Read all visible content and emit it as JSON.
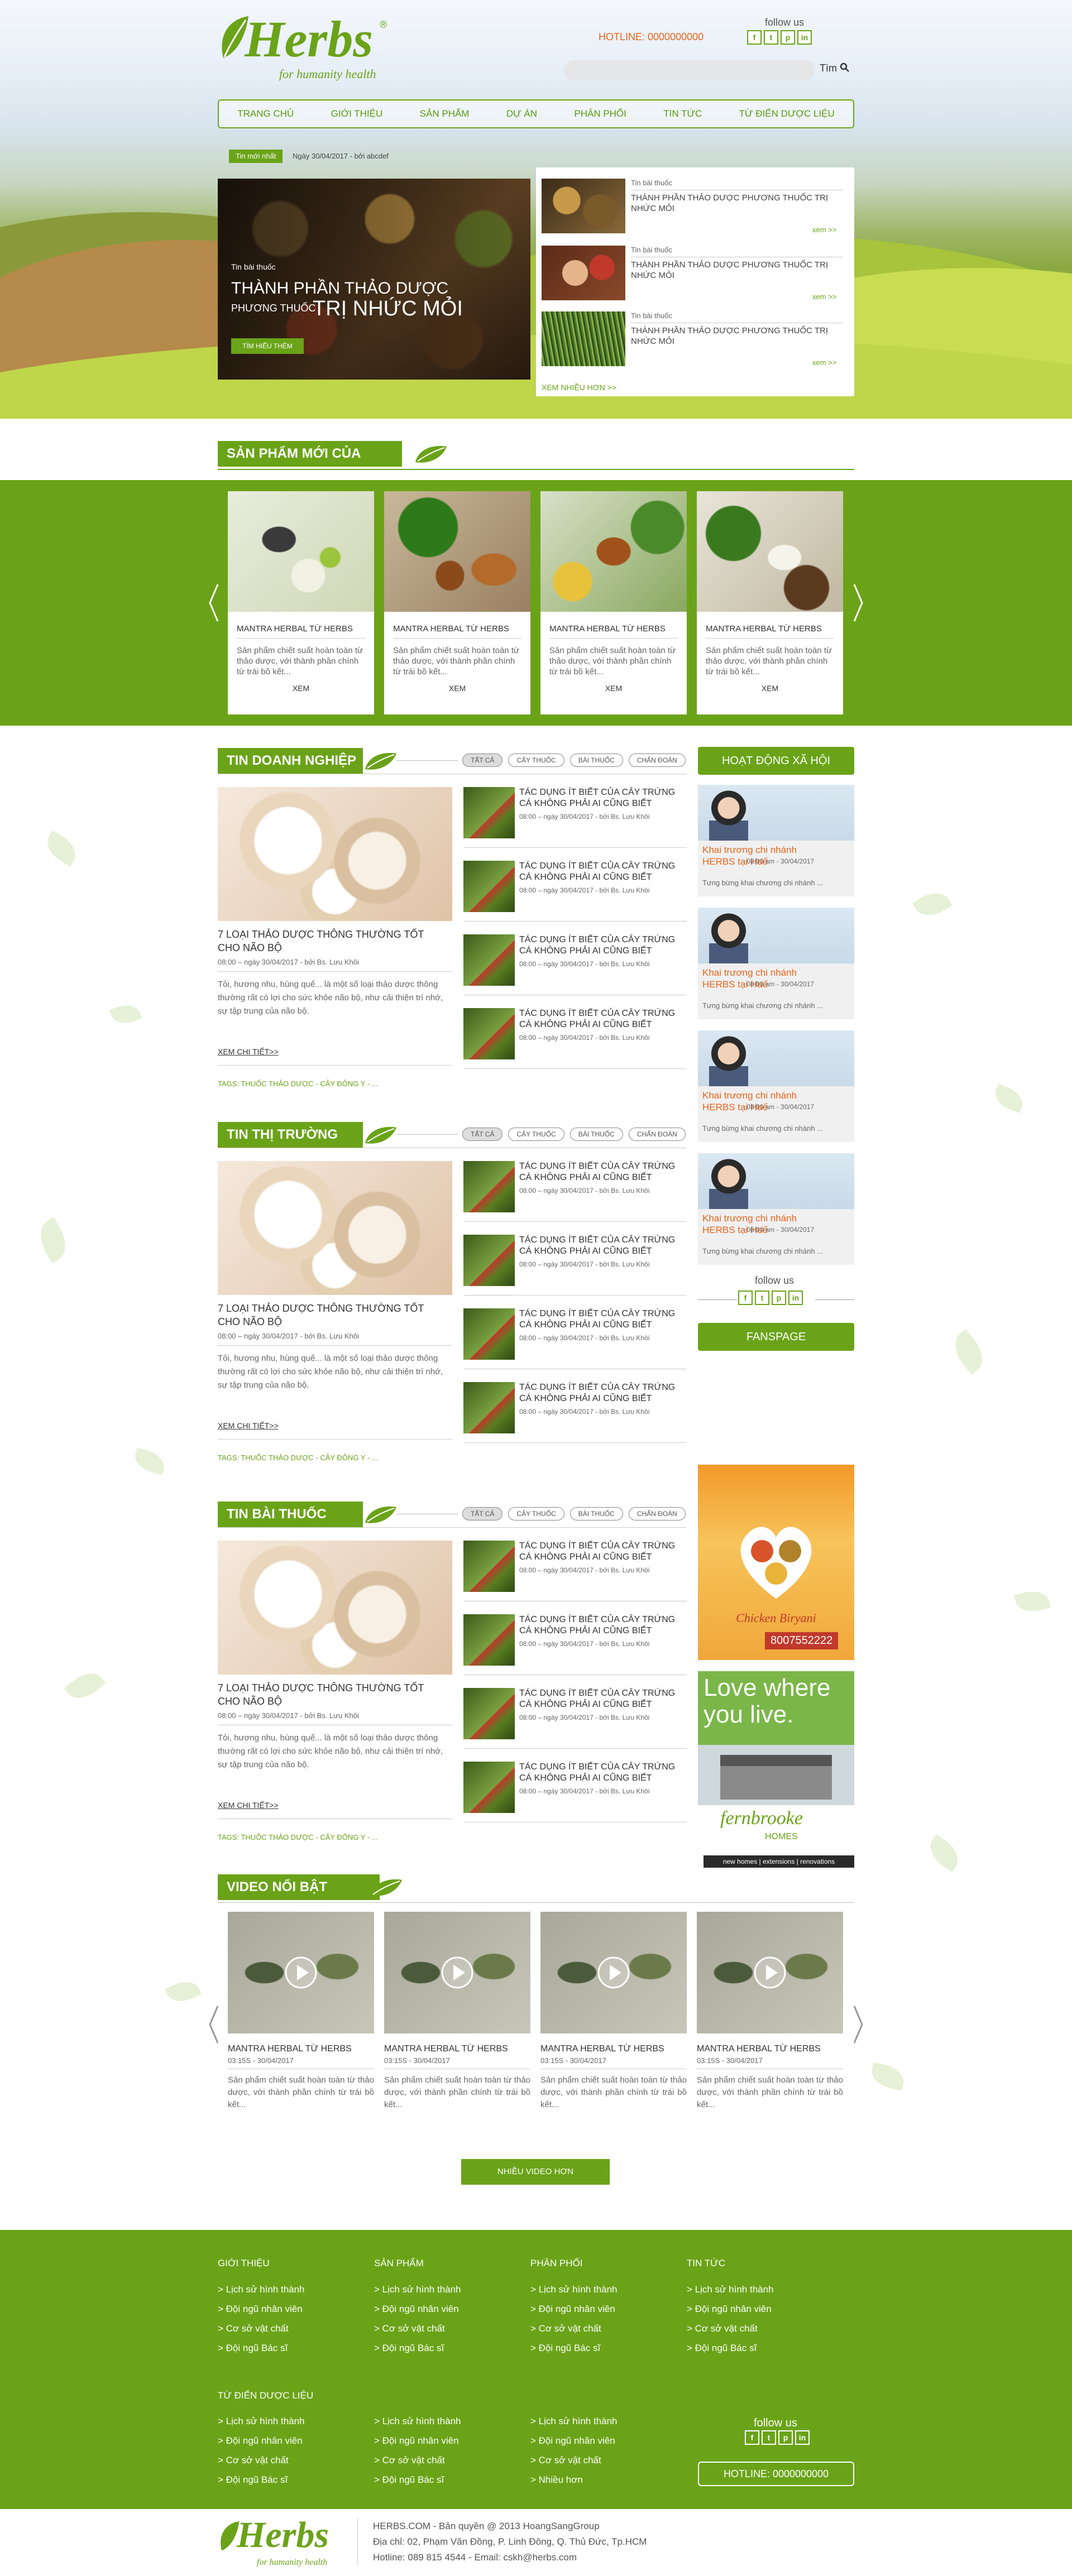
{
  "header": {
    "logo_text": "Herbs",
    "logo_reg": "®",
    "tagline": "for humanity health",
    "hotline": "HOTLINE: 0000000000",
    "follow": "follow us",
    "search_placeholder": "",
    "search_btn": "Tìm"
  },
  "social": [
    "f",
    "t",
    "p",
    "in"
  ],
  "nav": [
    "TRANG CHỦ",
    "GIỚI THIỆU",
    "SẢN PHẨM",
    "DỰ ÁN",
    "PHÂN PHỐI",
    "TIN TỨC",
    "TỪ ĐIỂN DƯỢC LIỆU"
  ],
  "ticker": {
    "label": "Tin mới nhất",
    "text": "Ngày 30/04/2017 - bởi abcdef"
  },
  "feature": {
    "cat": "Tin bài thuốc",
    "title1": "THÀNH PHẦN THẢO DƯỢC",
    "title2a": "PHƯƠNG THUỐC",
    "title2b": "TRỊ NHỨC MỎI",
    "btn": "TÌM HIỂU THÊM"
  },
  "side_news": [
    {
      "cat": "Tin bài thuốc",
      "title": "THÀNH PHẦN THẢO DƯỢC PHƯƠNG THUỐC TRỊ NHỨC MỎI",
      "more": "xem >>"
    },
    {
      "cat": "Tin bài thuốc",
      "title": "THÀNH PHẦN THẢO DƯỢC PHƯƠNG THUỐC TRỊ NHỨC MỎI",
      "more": "xem >>"
    },
    {
      "cat": "Tin bài thuốc",
      "title": "THÀNH PHẦN THẢO DƯỢC PHƯƠNG THUỐC TRỊ NHỨC MỎI",
      "more": "xem >>"
    }
  ],
  "side_more": "XEM NHIỀU HƠN >>",
  "products": {
    "title": "SẢN PHẨM MỚI CỦA HERBS",
    "items": [
      {
        "name": "MANTRA HERBAL TỪ HERBS",
        "desc": "Sản phẩm chiết suất hoàn toàn từ thảo dược, với thành phần chính từ trái bồ kết...",
        "btn": "XEM"
      },
      {
        "name": "MANTRA HERBAL TỪ HERBS",
        "desc": "Sản phẩm chiết suất hoàn toàn từ thảo dược, với thành phần chính từ trái bồ kết...",
        "btn": "XEM"
      },
      {
        "name": "MANTRA HERBAL TỪ HERBS",
        "desc": "Sản phẩm chiết suất hoàn toàn từ thảo dược, với thành phần chính từ trái bồ kết...",
        "btn": "XEM"
      },
      {
        "name": "MANTRA HERBAL TỪ HERBS",
        "desc": "Sản phẩm chiết suất hoàn toàn từ thảo dược, với thành phần chính từ trái bồ kết...",
        "btn": "XEM"
      }
    ]
  },
  "tags": [
    "TẤT CẢ",
    "CÂY THUỐC",
    "BÀI THUỐC",
    "CHẨN ĐOÁN"
  ],
  "sections": [
    {
      "title": "TIN DOANH NGHIỆP",
      "main_title": "7 LOẠI THẢO DƯỢC THÔNG THƯỜNG TỐT CHO NÃO BỘ",
      "main_meta": "08:00 – ngày 30/04/2017 - bởi Bs. Lưu Khôi",
      "main_desc": "Tỏi, hương nhu, hùng quế... là một số loại thảo dược thông thường rất có lợi cho sức khỏe não bộ, như cải thiện trí nhớ, sự tập trung của não bộ.",
      "more": "XEM CHI TIẾT>>",
      "tags_line": "TAGS: THUỐC THẢO DƯỢC - CÂY ĐÔNG Y - ..."
    },
    {
      "title": "TIN THỊ TRƯỜNG",
      "main_title": "7 LOẠI THẢO DƯỢC THÔNG THƯỜNG TỐT CHO NÃO BỘ",
      "main_meta": "08:00 – ngày 30/04/2017 - bởi Bs. Lưu Khôi",
      "main_desc": "Tỏi, hương nhu, hùng quế... là một số loại thảo dược thông thường rất có lợi cho sức khỏe não bộ, như cải thiện trí nhớ, sự tập trung của não bộ.",
      "more": "XEM CHI TIẾT>>",
      "tags_line": "TAGS: THUỐC THẢO DƯỢC - CÂY ĐÔNG Y - ..."
    },
    {
      "title": "TIN BÀI THUỐC",
      "main_title": "7 LOẠI THẢO DƯỢC THÔNG THƯỜNG TỐT CHO NÃO BỘ",
      "main_meta": "08:00 – ngày 30/04/2017 - bởi Bs. Lưu Khôi",
      "main_desc": "Tỏi, hương nhu, hùng quế... là một số loại thảo dược thông thường rất có lợi cho sức khỏe não bộ, như cải thiện trí nhớ, sự tập trung của não bộ.",
      "more": "XEM CHI TIẾT>>",
      "tags_line": "TAGS: THUỐC THẢO DƯỢC - CÂY ĐÔNG Y - ..."
    }
  ],
  "small_news": {
    "title": "TÁC DỤNG ÍT BIẾT CỦA CÂY TRỨNG CÁ KHÔNG PHẢI AI CŨNG BIẾT",
    "meta": "08:00 – ngày 30/04/2017 - bởi Bs. Lưu Khôi"
  },
  "social_act": {
    "title": "HOẠT ĐỘNG XÃ HỘI",
    "item_title": "Khai trương chi nhánh HERBS tại Huế",
    "item_time": "- 08:00 am - 30/04/2017",
    "item_desc": "Tưng bừng khai chương chi nhánh ..."
  },
  "fanspage": "FANSPAGE",
  "ads": {
    "ad1_title": "Chicken Biryani",
    "ad1_phone": "8007552222",
    "ad2_line1": "Love where",
    "ad2_line2": "you live.",
    "ad2_brand": "fernbrooke",
    "ad2_sub": "HOMES",
    "ad2_foot": "new homes | extensions | renovations"
  },
  "videos": {
    "title": "VIDEO NỔI BẬT",
    "item_title": "MANTRA HERBAL TỪ HERBS",
    "item_meta": "03:15S - 30/04/2017",
    "item_desc": "Sản phẩm chiết suất hoàn toàn từ thảo dược, với thành phần chính từ trái bồ kết...",
    "more": "NHIỀU VIDEO HƠN"
  },
  "footer": {
    "cols": [
      {
        "title": "GIỚI THIỆU",
        "items": [
          "> Lịch sử hình thành",
          "> Đội ngũ nhân viên",
          "> Cơ sở vật chất",
          "> Đội ngũ Bác sĩ"
        ]
      },
      {
        "title": "SẢN PHẨM",
        "items": [
          "> Lịch sử hình thành",
          "> Đội ngũ nhân viên",
          "> Cơ sở vật chất",
          "> Đội ngũ Bác sĩ"
        ]
      },
      {
        "title": "PHÂN PHỐI",
        "items": [
          "> Lịch sử hình thành",
          "> Đội ngũ nhân viên",
          "> Cơ sở vật chất",
          "> Đội ngũ Bác sĩ"
        ]
      },
      {
        "title": "TIN TỨC",
        "items": [
          "> Lịch sử hình thành",
          "> Đội ngũ nhân viên",
          "> Cơ sở vật chất",
          "> Đội ngũ Bác sĩ"
        ]
      }
    ],
    "cols2_title": "TỪ ĐIỂN DƯỢC LIỆU",
    "cols2": [
      [
        "> Lịch sử hình thành",
        "> Đội ngũ nhân viên",
        "> Cơ sở vật chất",
        "> Đội ngũ Bác sĩ"
      ],
      [
        "> Lịch sử hình thành",
        "> Đội ngũ nhân viên",
        "> Cơ sở vật chất",
        "> Đội ngũ Bác sĩ"
      ],
      [
        "> Lịch sử hình thành",
        "> Đội ngũ nhân viên",
        "> Cơ sở vật chất",
        "> Nhiều hơn"
      ]
    ],
    "follow": "follow us",
    "hotline": "HOTLINE: 0000000000",
    "copyright": "HERBS.COM - Bản quyền @ 2013 HoangSangGroup",
    "address": "Địa chỉ: 02, Phạm Văn Đồng, P. Linh Đông, Q. Thủ Đức, Tp.HCM",
    "contact": "Hotline: 089 815 4544 - Email: cskh@herbs.com"
  },
  "colors": {
    "brand": "#6aa318",
    "footer": "#6aa318",
    "accent": "#e8651a"
  }
}
